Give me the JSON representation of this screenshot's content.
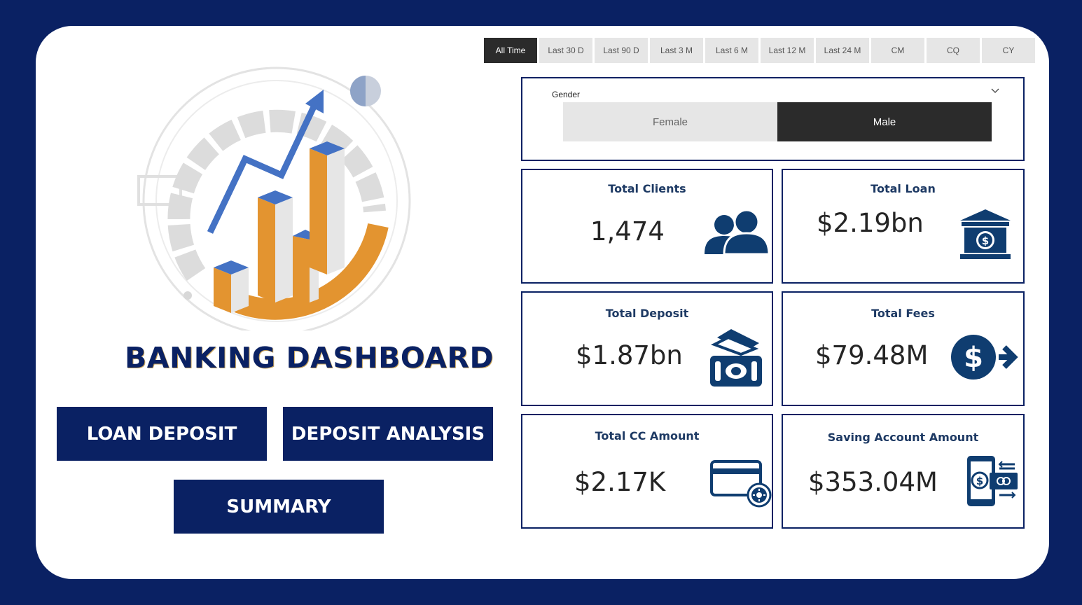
{
  "date_filter": {
    "tabs": [
      "All Time",
      "Last 30 D",
      "Last 90 D",
      "Last 3 M",
      "Last 6 M",
      "Last 12 M",
      "Last 24 M",
      "CM",
      "CQ",
      "CY"
    ],
    "active": "All Time"
  },
  "gender_slicer": {
    "label": "Gender",
    "options": [
      "Female",
      "Male"
    ],
    "selected": "Male"
  },
  "kpis": {
    "total_clients": {
      "title": "Total Clients",
      "value": "1,474",
      "icon": "people-icon"
    },
    "total_loan": {
      "title": "Total Loan",
      "value": "$2.19bn",
      "icon": "bank-icon"
    },
    "total_deposit": {
      "title": "Total Deposit",
      "value": "$1.87bn",
      "icon": "cash-icon"
    },
    "total_fees": {
      "title": "Total Fees",
      "value": "$79.48M",
      "icon": "dollar-arrow-icon"
    },
    "total_cc_amount": {
      "title": "Total CC Amount",
      "value": "$2.17K",
      "icon": "credit-card-gear-icon"
    },
    "saving_account_amount": {
      "title": "Saving Account Amount",
      "value": "$353.04M",
      "icon": "mobile-payment-icon"
    }
  },
  "dashboard_title": "BANKING DASHBOARD",
  "nav": {
    "loan_deposit": "LOAN DEPOSIT",
    "deposit_analysis": "DEPOSIT ANALYSIS",
    "summary": "SUMMARY"
  },
  "colors": {
    "navy": "#0a2163",
    "icon_blue": "#0f3d70",
    "orange": "#e39430",
    "chart_blue": "#4472c4",
    "slicer_dark": "#2b2b2b"
  }
}
